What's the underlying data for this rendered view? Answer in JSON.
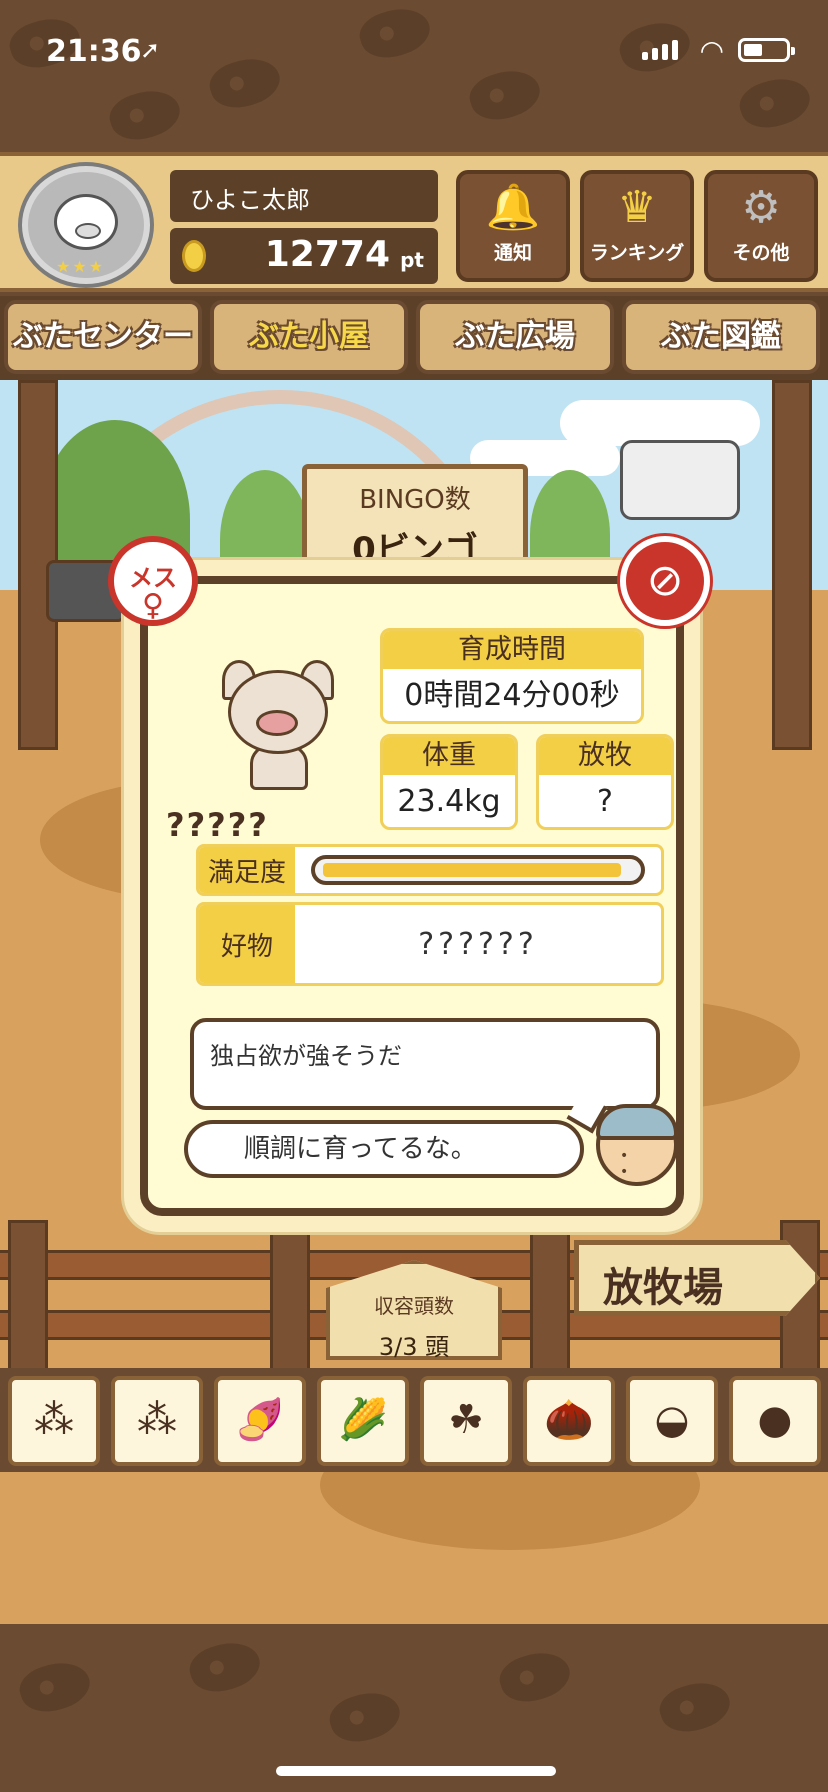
{
  "status_bar": {
    "time": "21:36",
    "location_icon": "location-arrow-icon",
    "signal_icon": "cellular-signal-icon",
    "wifi_icon": "wifi-icon",
    "battery_icon": "battery-icon"
  },
  "header": {
    "player_name": "ひよこ太郎",
    "points_value": "12774",
    "points_unit": "pt",
    "buttons": [
      {
        "label": "通知",
        "icon": "bell-icon"
      },
      {
        "label": "ランキング",
        "icon": "crown-icon"
      },
      {
        "label": "その他",
        "icon": "gear-icon"
      }
    ]
  },
  "nav": {
    "tabs": [
      {
        "label": "ぶたセンター",
        "active": false
      },
      {
        "label": "ぶた小屋",
        "active": true
      },
      {
        "label": "ぶた広場",
        "active": false
      },
      {
        "label": "ぶた図鑑",
        "active": false
      }
    ]
  },
  "scene": {
    "sign_title": "BINGO数",
    "sign_value": "0ビンゴ",
    "capacity_label": "収容頭数",
    "capacity_value": "3/3 頭",
    "pasture_sign": "放牧場"
  },
  "pig_card": {
    "gender_badge": "メス",
    "gender_symbol": "♀",
    "no_injection_icon": "no-injection-icon",
    "name": "?????",
    "growth_time_label": "育成時間",
    "growth_time_value": "0時間24分00秒",
    "weight_label": "体重",
    "weight_value": "23.4kg",
    "grazing_label": "放牧",
    "grazing_value": "?",
    "satisfaction_label": "満足度",
    "satisfaction_level": 0.96,
    "favorite_label": "好物",
    "favorite_value": "??????",
    "trait_text": "独占欲が強そうだ",
    "farmer_comment": "順調に育ってるな。"
  },
  "feeds": [
    {
      "icon": "grain-pile-icon",
      "glyph": "⁂"
    },
    {
      "icon": "mixed-grain-icon",
      "glyph": "⁂"
    },
    {
      "icon": "sweet-potato-icon",
      "glyph": "🍠"
    },
    {
      "icon": "corn-icon",
      "glyph": "🌽"
    },
    {
      "icon": "beans-icon",
      "glyph": "☘"
    },
    {
      "icon": "acorn-icon",
      "glyph": "🌰"
    },
    {
      "icon": "grain-plate-icon",
      "glyph": "◒"
    },
    {
      "icon": "dark-balls-plate-icon",
      "glyph": "●"
    }
  ],
  "colors": {
    "accent_yellow": "#f3cf45",
    "wood_dark": "#5c4128",
    "alert_red": "#c9352b"
  }
}
